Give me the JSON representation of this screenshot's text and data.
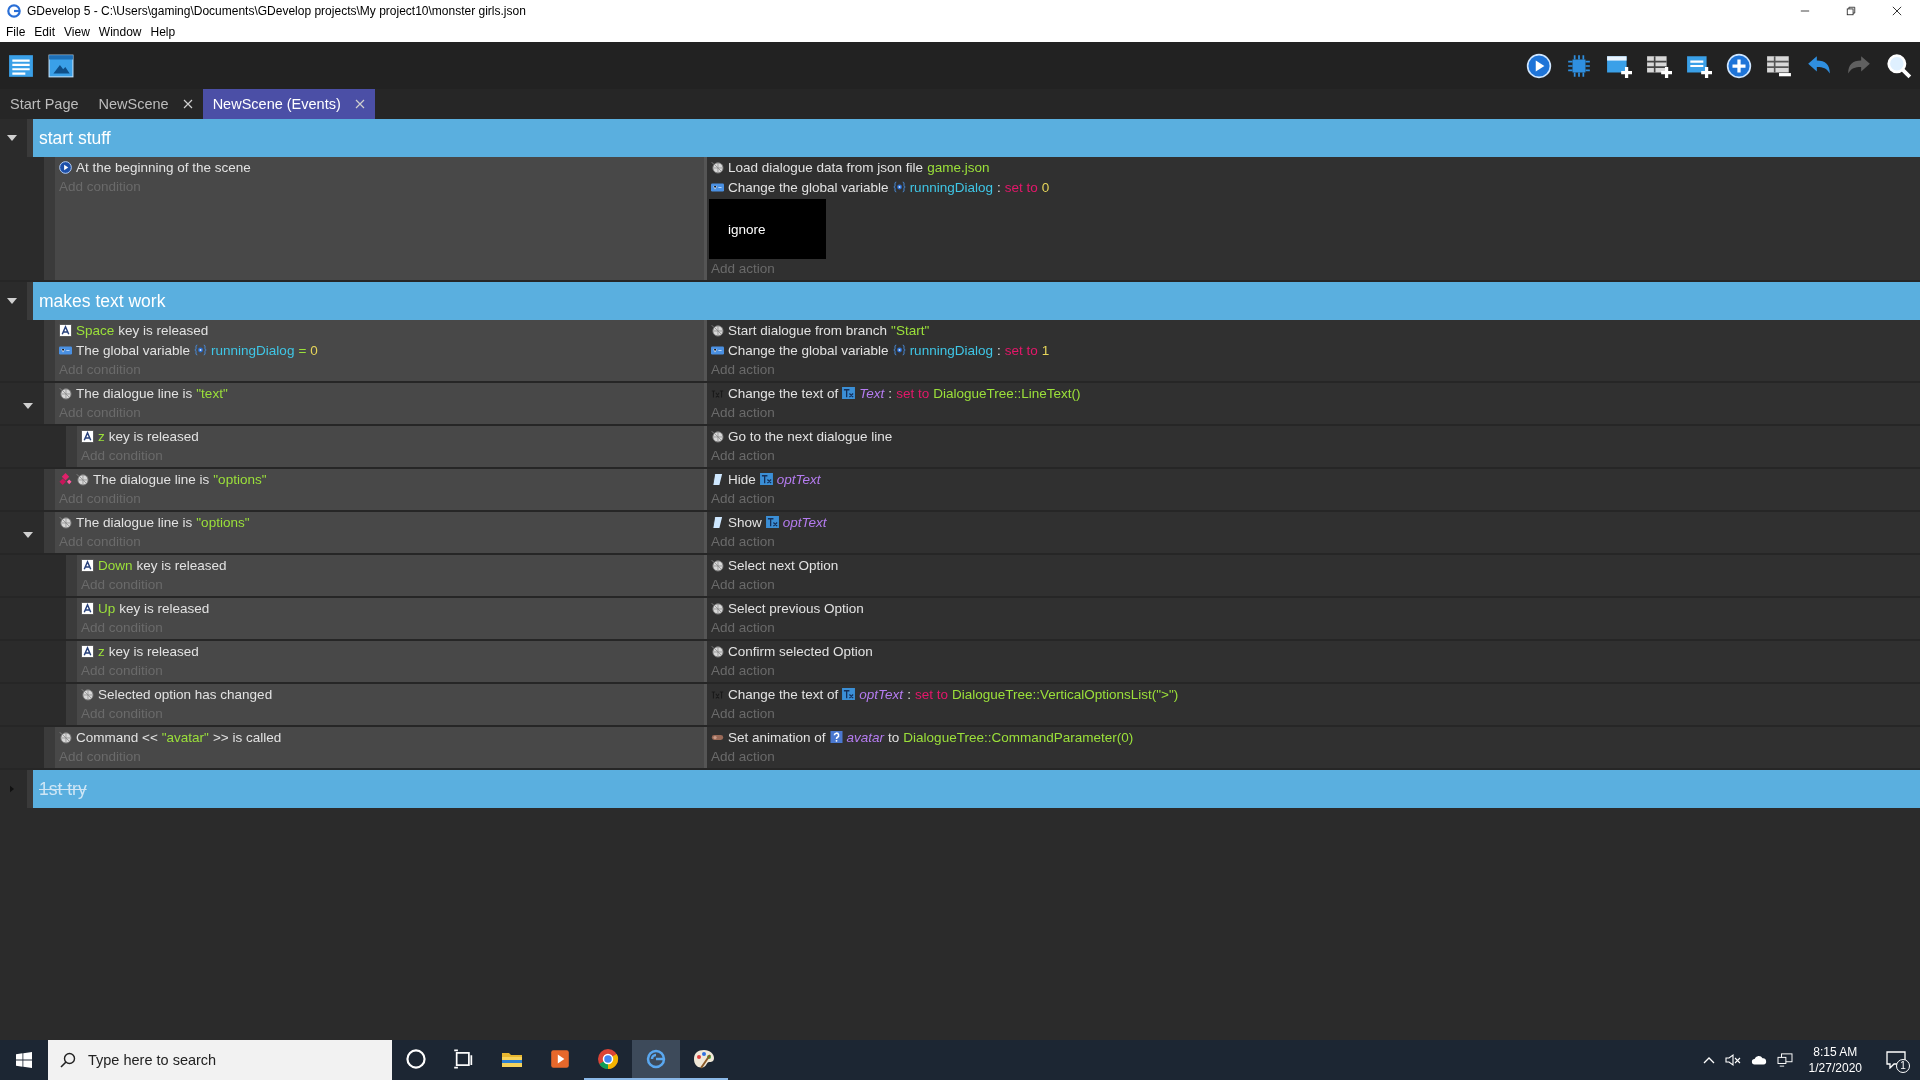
{
  "window": {
    "title": "GDevelop 5 - C:\\Users\\gaming\\Documents\\GDevelop projects\\My project10\\monster girls.json"
  },
  "menu": [
    "File",
    "Edit",
    "View",
    "Window",
    "Help"
  ],
  "toolbar": {
    "left": [
      {
        "kind": "events-list",
        "disabled": false
      },
      {
        "kind": "scene-window",
        "disabled": false
      }
    ],
    "right": [
      {
        "kind": "play",
        "disabled": false
      },
      {
        "kind": "chip",
        "disabled": false
      },
      {
        "kind": "add-window",
        "disabled": false
      },
      {
        "kind": "add-table",
        "disabled": false
      },
      {
        "kind": "add-list",
        "disabled": false
      },
      {
        "kind": "add-circle",
        "disabled": false
      },
      {
        "kind": "remove-table",
        "disabled": false
      },
      {
        "kind": "undo",
        "disabled": false
      },
      {
        "kind": "redo",
        "disabled": true
      },
      {
        "kind": "search",
        "disabled": false
      }
    ]
  },
  "tabs": [
    {
      "label": "Start Page",
      "closable": false,
      "selected": false
    },
    {
      "label": "NewScene",
      "closable": true,
      "selected": false
    },
    {
      "label": "NewScene (Events)",
      "closable": true,
      "selected": true
    }
  ],
  "groups": [
    {
      "title": "start stuff",
      "expanded": true,
      "disabled": false,
      "events": [
        {
          "add_condition": "Add condition",
          "add_action": "Add action",
          "conditions": [
            {
              "kind": "scene-start",
              "inverted": false,
              "parts": [
                {
                  "kind": "text",
                  "text": "At the beginning of the scene"
                }
              ]
            }
          ],
          "actions": [
            {
              "kind": "dialogue",
              "parts": [
                {
                  "kind": "text",
                  "text": "Load dialogue data from json file"
                },
                {
                  "kind": "string",
                  "text": "game.json"
                }
              ]
            },
            {
              "kind": "variable",
              "parts": [
                {
                  "kind": "text",
                  "text": "Change the global variable"
                },
                {
                  "kind": "variable",
                  "text": "runningDialog"
                },
                {
                  "kind": "text",
                  "text": ":"
                },
                {
                  "kind": "operator",
                  "text": "set to"
                },
                {
                  "kind": "number",
                  "text": "0"
                }
              ]
            },
            {
              "kind": "note",
              "text": "ignore"
            }
          ]
        }
      ]
    },
    {
      "title": "makes text work",
      "expanded": true,
      "disabled": false,
      "events": [
        {
          "add_condition": "Add condition",
          "add_action": "Add action",
          "conditions": [
            {
              "kind": "key",
              "inverted": false,
              "parts": [
                {
                  "kind": "string",
                  "text": "Space"
                },
                {
                  "kind": "text",
                  "text": "key is released"
                }
              ]
            },
            {
              "kind": "variable",
              "inverted": false,
              "parts": [
                {
                  "kind": "text",
                  "text": "The global variable"
                },
                {
                  "kind": "variable",
                  "text": "runningDialog"
                },
                {
                  "kind": "operator-green",
                  "text": "="
                },
                {
                  "kind": "number",
                  "text": "0"
                }
              ]
            }
          ],
          "actions": [
            {
              "kind": "dialogue",
              "parts": [
                {
                  "kind": "text",
                  "text": "Start dialogue from branch"
                },
                {
                  "kind": "string",
                  "text": "\"Start\""
                }
              ]
            },
            {
              "kind": "variable",
              "parts": [
                {
                  "kind": "text",
                  "text": "Change the global variable"
                },
                {
                  "kind": "variable",
                  "text": "runningDialog"
                },
                {
                  "kind": "text",
                  "text": ":"
                },
                {
                  "kind": "operator",
                  "text": "set to"
                },
                {
                  "kind": "number",
                  "text": "1"
                }
              ]
            }
          ]
        },
        {
          "add_condition": "Add condition",
          "add_action": "Add action",
          "expanded": true,
          "conditions": [
            {
              "kind": "dialogue",
              "inverted": false,
              "parts": [
                {
                  "kind": "text",
                  "text": "The dialogue line is"
                },
                {
                  "kind": "string",
                  "text": "\"text\""
                }
              ]
            }
          ],
          "actions": [
            {
              "kind": "text",
              "parts": [
                {
                  "kind": "text",
                  "text": "Change the text of"
                },
                {
                  "kind": "object",
                  "text": "Text"
                },
                {
                  "kind": "text",
                  "text": ":"
                },
                {
                  "kind": "operator",
                  "text": "set to"
                },
                {
                  "kind": "string",
                  "text": "DialogueTree::LineText()"
                }
              ]
            }
          ],
          "children": [
            {
              "add_condition": "Add condition",
              "add_action": "Add action",
              "conditions": [
                {
                  "kind": "key",
                  "inverted": false,
                  "parts": [
                    {
                      "kind": "string",
                      "text": "z"
                    },
                    {
                      "kind": "text",
                      "text": "key is released"
                    }
                  ]
                }
              ],
              "actions": [
                {
                  "kind": "dialogue",
                  "parts": [
                    {
                      "kind": "text",
                      "text": "Go to the next dialogue line"
                    }
                  ]
                }
              ]
            }
          ]
        },
        {
          "add_condition": "Add condition",
          "add_action": "Add action",
          "conditions": [
            {
              "kind": "dialogue",
              "inverted": true,
              "parts": [
                {
                  "kind": "text",
                  "text": "The dialogue line is"
                },
                {
                  "kind": "string",
                  "text": "\"options\""
                }
              ]
            }
          ],
          "actions": [
            {
              "kind": "visibility",
              "parts": [
                {
                  "kind": "text",
                  "text": "Hide"
                },
                {
                  "kind": "object",
                  "text": "optText"
                }
              ]
            }
          ]
        },
        {
          "add_condition": "Add condition",
          "add_action": "Add action",
          "expanded": true,
          "conditions": [
            {
              "kind": "dialogue",
              "inverted": false,
              "parts": [
                {
                  "kind": "text",
                  "text": "The dialogue line is"
                },
                {
                  "kind": "string",
                  "text": "\"options\""
                }
              ]
            }
          ],
          "actions": [
            {
              "kind": "visibility",
              "parts": [
                {
                  "kind": "text",
                  "text": "Show"
                },
                {
                  "kind": "object",
                  "text": "optText"
                }
              ]
            }
          ],
          "children": [
            {
              "add_condition": "Add condition",
              "add_action": "Add action",
              "conditions": [
                {
                  "kind": "key",
                  "inverted": false,
                  "parts": [
                    {
                      "kind": "string",
                      "text": "Down"
                    },
                    {
                      "kind": "text",
                      "text": "key is released"
                    }
                  ]
                }
              ],
              "actions": [
                {
                  "kind": "dialogue",
                  "parts": [
                    {
                      "kind": "text",
                      "text": "Select next Option"
                    }
                  ]
                }
              ]
            },
            {
              "add_condition": "Add condition",
              "add_action": "Add action",
              "conditions": [
                {
                  "kind": "key",
                  "inverted": false,
                  "parts": [
                    {
                      "kind": "string",
                      "text": "Up"
                    },
                    {
                      "kind": "text",
                      "text": "key is released"
                    }
                  ]
                }
              ],
              "actions": [
                {
                  "kind": "dialogue",
                  "parts": [
                    {
                      "kind": "text",
                      "text": "Select previous Option"
                    }
                  ]
                }
              ]
            },
            {
              "add_condition": "Add condition",
              "add_action": "Add action",
              "conditions": [
                {
                  "kind": "key",
                  "inverted": false,
                  "parts": [
                    {
                      "kind": "string",
                      "text": "z"
                    },
                    {
                      "kind": "text",
                      "text": "key is released"
                    }
                  ]
                }
              ],
              "actions": [
                {
                  "kind": "dialogue",
                  "parts": [
                    {
                      "kind": "text",
                      "text": "Confirm selected Option"
                    }
                  ]
                }
              ]
            },
            {
              "add_condition": "Add condition",
              "add_action": "Add action",
              "conditions": [
                {
                  "kind": "dialogue",
                  "inverted": false,
                  "parts": [
                    {
                      "kind": "text",
                      "text": "Selected option has changed"
                    }
                  ]
                }
              ],
              "actions": [
                {
                  "kind": "text",
                  "parts": [
                    {
                      "kind": "text",
                      "text": "Change the text of"
                    },
                    {
                      "kind": "object",
                      "text": "optText"
                    },
                    {
                      "kind": "text",
                      "text": ":"
                    },
                    {
                      "kind": "operator",
                      "text": "set to"
                    },
                    {
                      "kind": "string",
                      "text": "DialogueTree::VerticalOptionsList(\">\")"
                    }
                  ]
                }
              ]
            }
          ]
        },
        {
          "add_condition": "Add condition",
          "add_action": "Add action",
          "conditions": [
            {
              "kind": "dialogue",
              "inverted": false,
              "parts": [
                {
                  "kind": "text",
                  "text": "Command <<"
                },
                {
                  "kind": "string",
                  "text": "\"avatar\""
                },
                {
                  "kind": "text",
                  "text": ">> is called"
                }
              ]
            }
          ],
          "actions": [
            {
              "kind": "animation",
              "parts": [
                {
                  "kind": "text",
                  "text": "Set animation of"
                },
                {
                  "kind": "sprite",
                  "text": "avatar"
                },
                {
                  "kind": "text",
                  "text": "to"
                },
                {
                  "kind": "string",
                  "text": "DialogueTree::CommandParameter(0)"
                }
              ]
            }
          ]
        }
      ]
    },
    {
      "title": "1st try",
      "expanded": false,
      "disabled": true
    }
  ],
  "taskbar": {
    "search": {
      "placeholder": "Type here to search"
    },
    "apps": [
      {
        "kind": "cortana",
        "running": false,
        "selected": false
      },
      {
        "kind": "task-view",
        "running": false,
        "selected": false
      },
      {
        "kind": "folder",
        "running": false,
        "selected": false
      },
      {
        "kind": "media",
        "running": false,
        "selected": false
      },
      {
        "kind": "browser",
        "running": true,
        "selected": false
      },
      {
        "kind": "gdevelop",
        "running": true,
        "selected": true
      },
      {
        "kind": "paint",
        "running": true,
        "selected": false
      }
    ],
    "time": "8:15 AM",
    "date": "1/27/2020",
    "notifications": "1"
  }
}
